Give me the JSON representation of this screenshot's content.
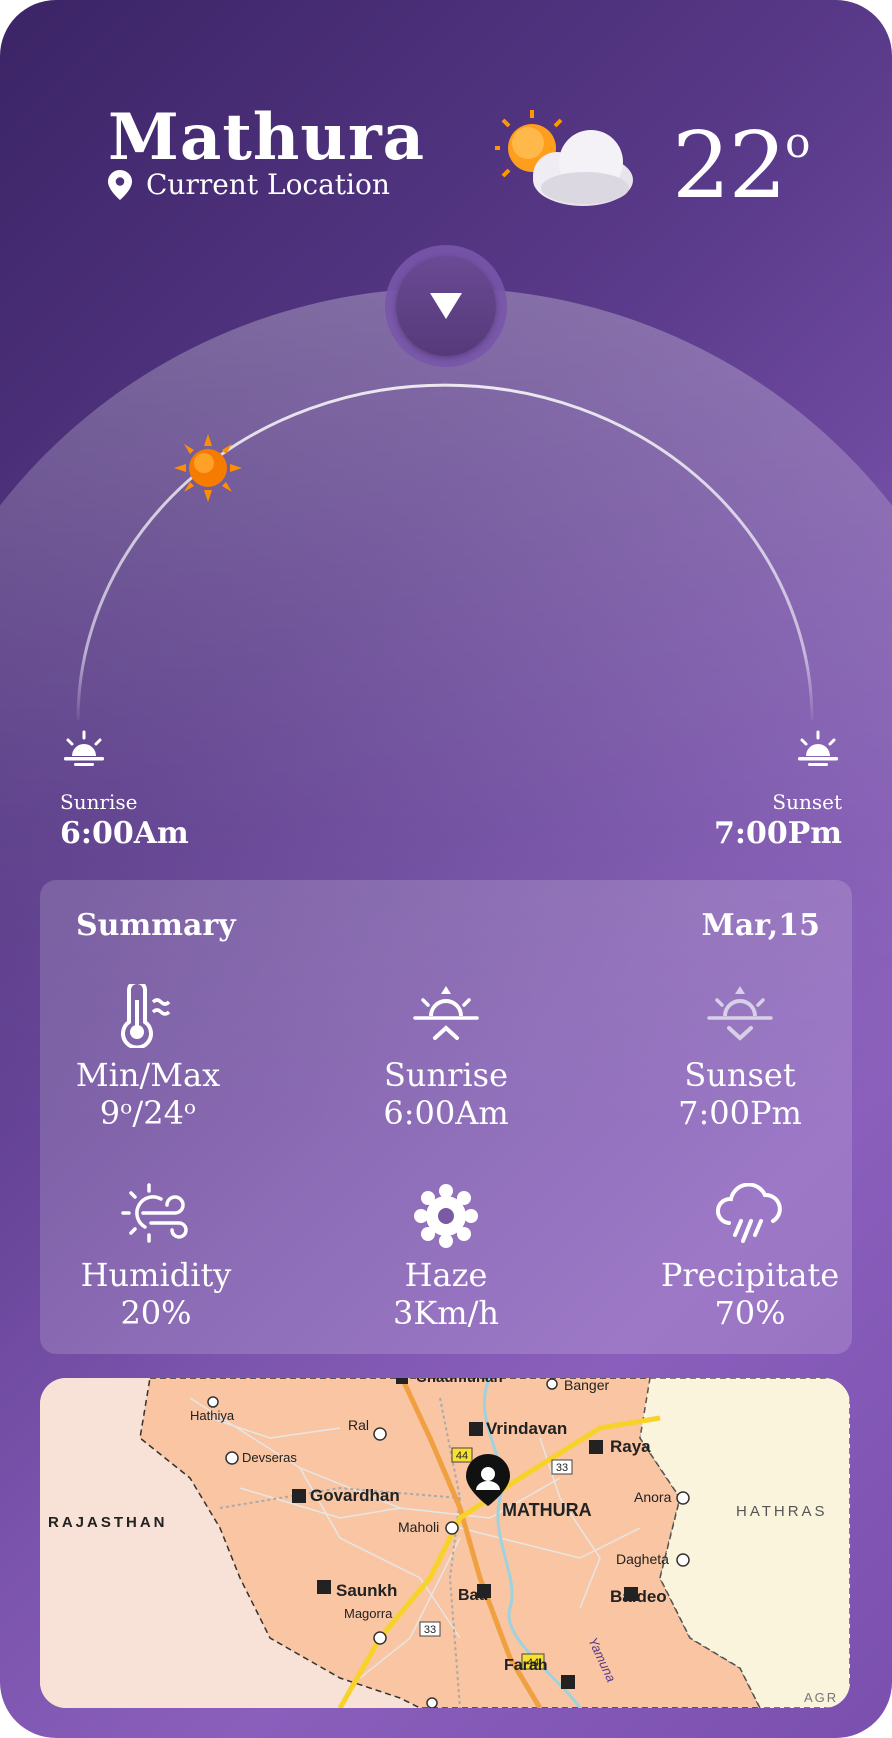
{
  "header": {
    "city": "Mathura",
    "location_label": "Current Location",
    "temperature": "22",
    "temperature_unit": "o",
    "condition_icon": "sun-behind-cloud-icon"
  },
  "sun_arc": {
    "sunrise_label": "Sunrise",
    "sunrise_time": "6:00Am",
    "sunset_label": "Sunset",
    "sunset_time": "7:00Pm"
  },
  "summary": {
    "title": "Summary",
    "date": "Mar,15",
    "items": [
      {
        "label": "Min/Max",
        "value": "9ᵒ/24ᵒ",
        "icon": "thermometer-icon"
      },
      {
        "label": "Sunrise",
        "value": "6:00Am",
        "icon": "sunrise-icon"
      },
      {
        "label": "Sunset",
        "value": "7:00Pm",
        "icon": "sunset-icon"
      },
      {
        "label": "Humidity",
        "value": "20%",
        "icon": "wind-sun-icon"
      },
      {
        "label": "Haze",
        "value": "3Km/h",
        "icon": "haze-icon"
      },
      {
        "label": "Precipitate",
        "value": "70%",
        "icon": "rain-cloud-icon"
      }
    ]
  },
  "map": {
    "labels": {
      "chaumuhan": "Chaumuhan",
      "banger": "Banger",
      "hathiya": "Hathiya",
      "vrindavan": "Vrindavan",
      "ral": "Ral",
      "raya": "Raya",
      "devseras": "Devseras",
      "rajasthan": "RAJASTHAN",
      "govardhan": "Govardhan",
      "mathura": "MATHURA",
      "anora": "Anora",
      "hathras": "HATHRAS",
      "maholi": "Maholi",
      "dagheta": "Dagheta",
      "saunkh": "Saunkh",
      "bad": "Bad",
      "baldeo": "Baldeo",
      "magorra": "Magorra",
      "farah": "Farah",
      "yamuna": "Yamuna",
      "agr": "AGR",
      "road_44a": "44",
      "road_44b": "44",
      "road_33a": "33",
      "road_33b": "33"
    }
  },
  "colors": {
    "bg_start": "#3b2466",
    "bg_end": "#8a5fbc",
    "sun_orange": "#f57c00"
  }
}
